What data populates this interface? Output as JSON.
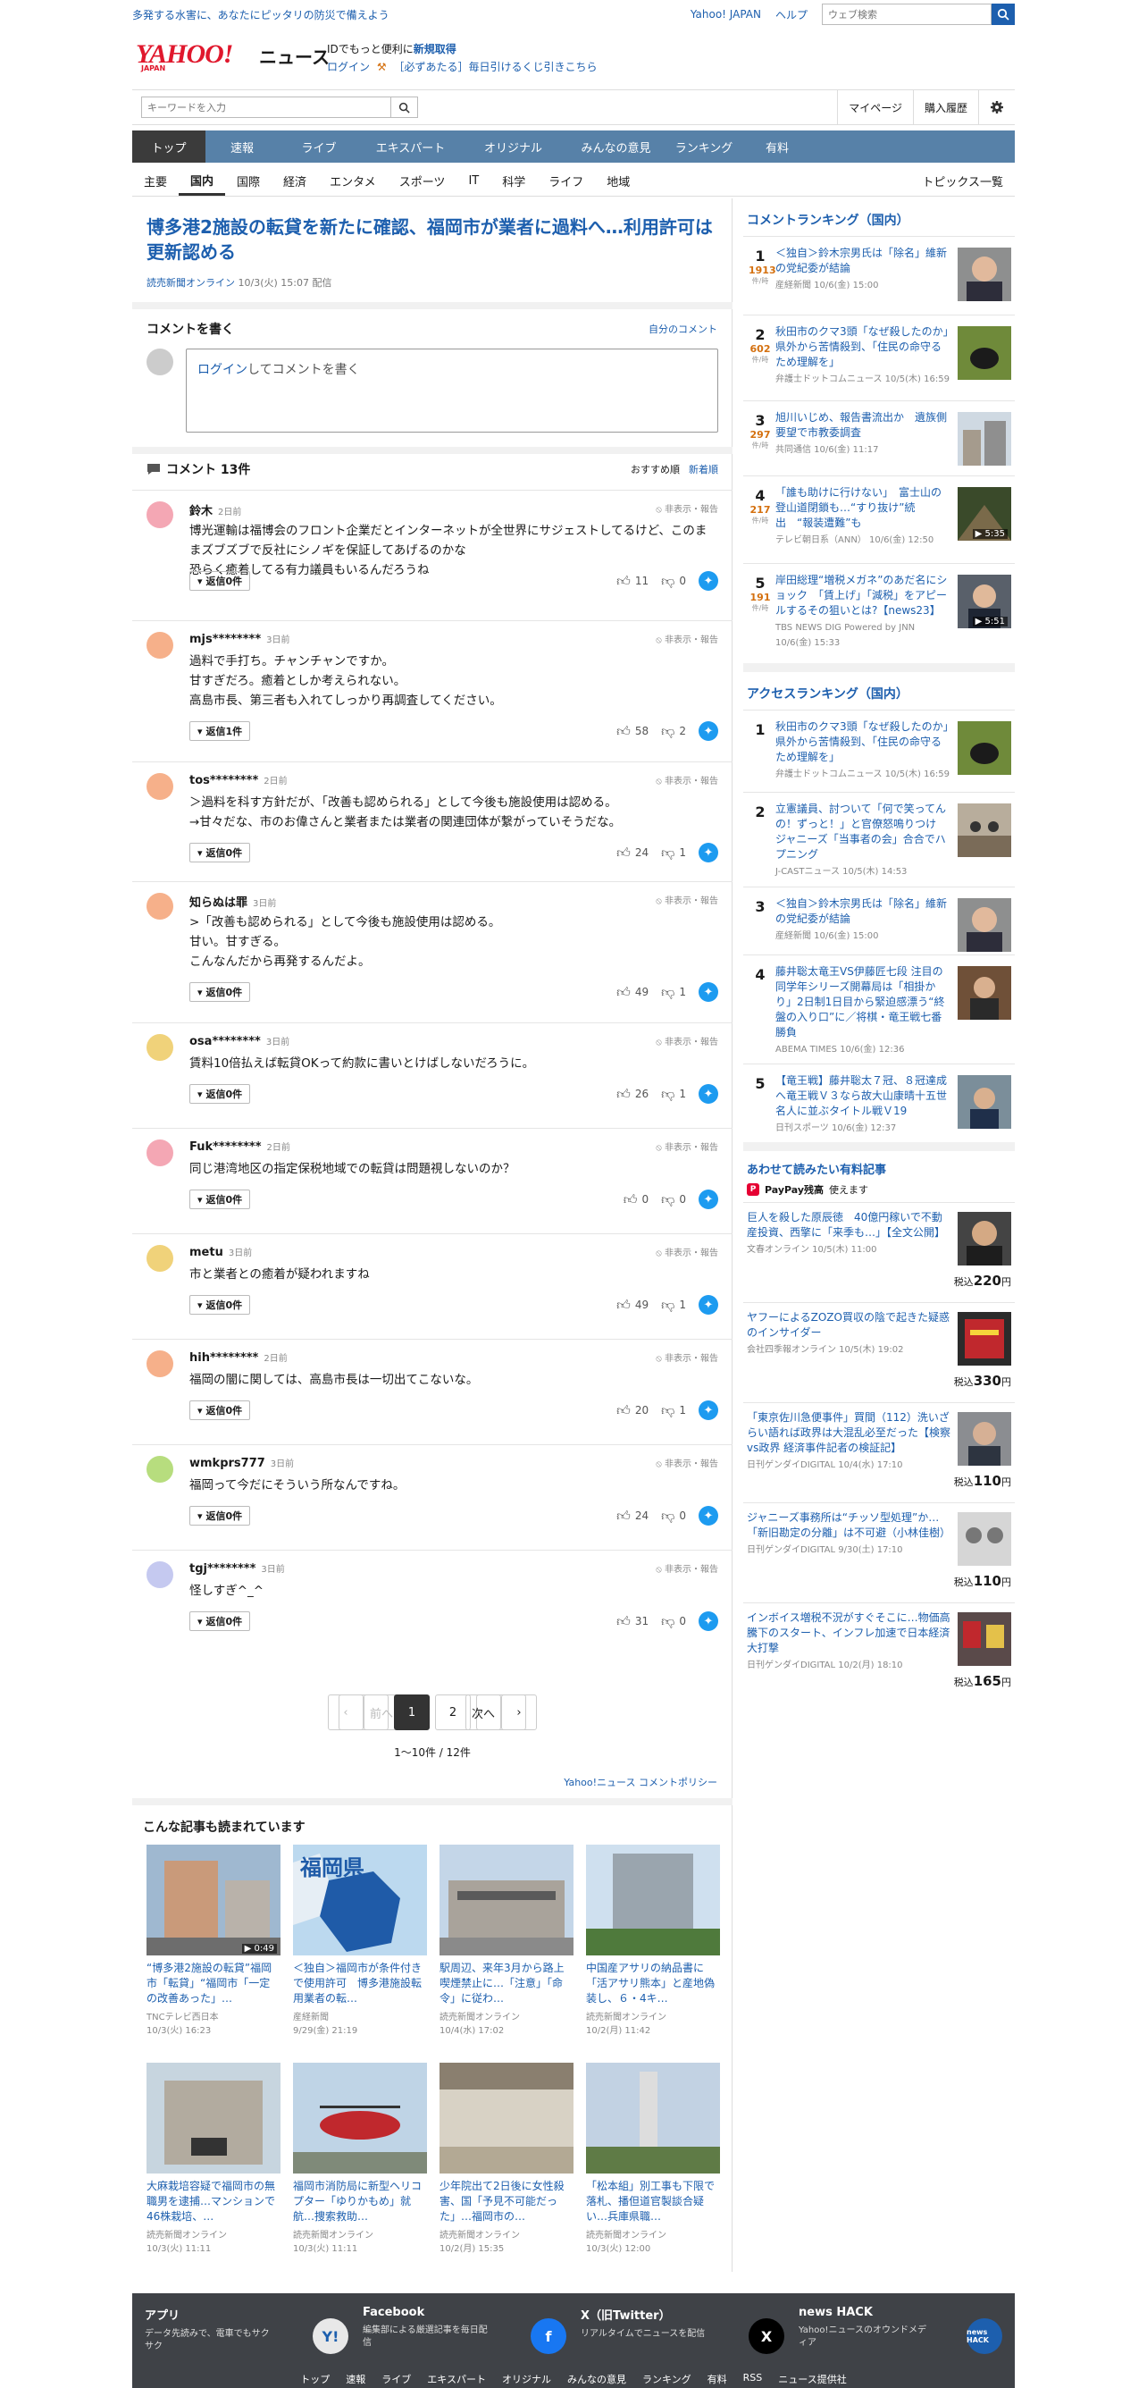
{
  "topbar": {
    "promo": "多発する水害に、あなたにピッタリの防災で備えよう",
    "yahoo_japan": "Yahoo! JAPAN",
    "help": "ヘルプ",
    "search_placeholder": "ウェブ検索"
  },
  "header": {
    "logo": "YAHOO!",
    "logo_sub": "JAPAN",
    "section": "ニュース",
    "id_text": "IDでもっと便利に",
    "signup": "新規取得",
    "login": "ログイン",
    "promo_link": "［必ずあたる］毎日引けるくじ引きこちら"
  },
  "util": {
    "keyword_placeholder": "キーワードを入力",
    "mypage": "マイページ",
    "purchase_history": "購入履歴"
  },
  "gnav": [
    "トップ",
    "速報",
    "ライブ",
    "エキスパート",
    "オリジナル",
    "みんなの意見",
    "ランキング",
    "有料"
  ],
  "cnav": [
    "主要",
    "国内",
    "国際",
    "経済",
    "エンタメ",
    "スポーツ",
    "IT",
    "科学",
    "ライフ",
    "地域"
  ],
  "cnav_topics": "トピックス一覧",
  "article": {
    "title": "博多港2施設の転貸を新たに確認、福岡市が業者に過料へ…利用許可は更新認める",
    "source": "読売新聞オンライン",
    "date": "10/3(火) 15:07 配信"
  },
  "comment_write": {
    "title": "コメントを書く",
    "self_link": "自分のコメント",
    "login": "ログイン",
    "prompt": "してコメントを書く"
  },
  "comments_header": {
    "title": "コメント 13件",
    "sort_recommended": "おすすめ順",
    "sort_new": "新着順"
  },
  "report_label": "非表示・報告",
  "comments": [
    {
      "user": "鈴木",
      "ago": "2日前",
      "body": "博光運輸は福博会のフロント企業だとインターネットが全世界にサジェストしてるけど、このままズブズブで反社にシノギを保証してあげるのかな\n恐らく癒着してる有力議員もいるんだろうね",
      "reply": "返信0件",
      "likes": "11",
      "dislikes": "0",
      "avatar_color": "#f4a7b4"
    },
    {
      "user": "mjs********",
      "ago": "3日前",
      "body": "過料で手打ち。チャンチャンですか。\n甘すぎだろ。癒着としか考えられない。\n高島市長、第三者も入れてしっかり再調査してください。",
      "reply": "返信1件",
      "likes": "58",
      "dislikes": "2",
      "avatar_color": "#f6b08a"
    },
    {
      "user": "tos********",
      "ago": "2日前",
      "body": "＞過料を科す方針だが、「改善も認められる」として今後も施設使用は認める。\n→甘々だな、市のお偉さんと業者または業者の関連団体が繋がっていそうだな。",
      "reply": "返信0件",
      "likes": "24",
      "dislikes": "1",
      "avatar_color": "#f6b08a"
    },
    {
      "user": "知らぬは罪",
      "ago": "3日前",
      "body": ">「改善も認められる」として今後も施設使用は認める。\n甘い。甘すぎる。\nこんなんだから再発するんだよ。",
      "reply": "返信0件",
      "likes": "49",
      "dislikes": "1",
      "avatar_color": "#f6b08a"
    },
    {
      "user": "osa********",
      "ago": "3日前",
      "body": "賃料10倍払えば転貸OKって約款に書いとけばしないだろうに。",
      "reply": "返信0件",
      "likes": "26",
      "dislikes": "1",
      "avatar_color": "#f0d27a"
    },
    {
      "user": "Fuk********",
      "ago": "2日前",
      "body": "同じ港湾地区の指定保税地域での転貸は問題視しないのか？",
      "reply": "返信0件",
      "likes": "0",
      "dislikes": "0",
      "avatar_color": "#f4a7b4"
    },
    {
      "user": "metu",
      "ago": "3日前",
      "body": "市と業者との癒着が疑われますね",
      "reply": "返信0件",
      "likes": "49",
      "dislikes": "1",
      "avatar_color": "#f0d27a"
    },
    {
      "user": "hih********",
      "ago": "2日前",
      "body": "福岡の闇に関しては、高島市長は一切出てこないな。",
      "reply": "返信0件",
      "likes": "20",
      "dislikes": "1",
      "avatar_color": "#f6b08a"
    },
    {
      "user": "wmkprs777",
      "ago": "3日前",
      "body": "福岡って今だにそういう所なんですね。",
      "reply": "返信0件",
      "likes": "24",
      "dislikes": "0",
      "avatar_color": "#b7dd7e"
    },
    {
      "user": "tgj********",
      "ago": "3日前",
      "body": "怪しすぎ^_^",
      "reply": "返信0件",
      "likes": "31",
      "dislikes": "0",
      "avatar_color": "#c5c9f0"
    }
  ],
  "pager": {
    "prev": "前へ",
    "pages": [
      "1",
      "2"
    ],
    "next": "次へ",
    "count": "1〜10件 / 12件"
  },
  "policy": "Yahoo!ニュース コメントポリシー",
  "related": {
    "title": "こんな記事も読まれています",
    "items": [
      {
        "title": "“博多港2施設の転貸”福岡市「転貸」“福岡市「一定の改善あった」…",
        "source": "TNCテレビ西日本",
        "date": "10/3(火) 16:23",
        "badge": "0:49",
        "img": "building"
      },
      {
        "title": "＜独自＞福岡市が条件付きで使用許可　博多港施設転用業者の転…",
        "source": "産経新聞",
        "date": "9/29(金) 21:19",
        "img": "map",
        "map_label": "福岡県"
      },
      {
        "title": "駅周辺、来年3月から路上喫煙禁止に…「注意」「命令」に従わ…",
        "source": "読売新聞オンライン",
        "date": "10/4(水) 17:02",
        "img": "station"
      },
      {
        "title": "中国産アサリの納品書に「活アサリ熊本」と産地偽装し、６・4キ…",
        "source": "読売新聞オンライン",
        "date": "10/2(月) 11:42",
        "img": "office"
      },
      {
        "title": "大麻栽培容疑で福岡市の無職男を逮捕…マンションで46株栽培、…",
        "source": "読売新聞オンライン",
        "date": "10/3(火) 11:11",
        "img": "police"
      },
      {
        "title": "福岡市消防局に新型ヘリコプター「ゆりかもめ」就航…捜索救助…",
        "source": "読売新聞オンライン",
        "date": "10/3(火) 11:11",
        "img": "heli"
      },
      {
        "title": "少年院出て2日後に女性殺害、国「予見不可能だった」…福岡市の…",
        "source": "読売新聞オンライン",
        "date": "10/2(月) 15:35",
        "img": "mall"
      },
      {
        "title": "「松本組」別工事も下限で落札、播但道官製談合疑い…兵庫県職…",
        "source": "読売新聞オンライン",
        "date": "10/3(火) 12:00",
        "img": "sign"
      }
    ]
  },
  "comment_ranking": {
    "title": "コメントランキング（国内）",
    "unit": "件/時",
    "items": [
      {
        "rank": "1",
        "count": "1913",
        "title": "＜独自＞鈴木宗男氏は「除名」維新の党紀委が結論",
        "meta": "産経新聞 10/6(金) 15:00",
        "img": "man"
      },
      {
        "rank": "2",
        "count": "602",
        "title": "秋田市のクマ3頭「なぜ殺したのか」　県外から苦情殺到、「住民の命守るため理解を」",
        "meta": "弁護士ドットコムニュース 10/5(木) 16:59",
        "img": "bear"
      },
      {
        "rank": "3",
        "count": "297",
        "title": "旭川いじめ、報告書流出か　遺族側要望で市教委調査",
        "meta": "共同通信 10/6(金) 11:17",
        "img": "city"
      },
      {
        "rank": "4",
        "count": "217",
        "title": "「誰も助けに行けない」　富士山の登山道閉鎖も…“すり抜け”続出　“報装遭難”も",
        "meta": "テレビ朝日系（ANN） 10/6(金) 12:50",
        "img": "mountain",
        "badge": "5:35"
      },
      {
        "rank": "5",
        "count": "191",
        "title": "岸田総理“増税メガネ”のあだ名にショック　「賃上げ」「減税」をアピールするその狙いとは?【news23】",
        "meta": "TBS NEWS DIG Powered by JNN 10/6(金) 15:33",
        "img": "pm",
        "badge": "5:51"
      }
    ]
  },
  "access_ranking": {
    "title": "アクセスランキング（国内）",
    "items": [
      {
        "rank": "1",
        "title": "秋田市のクマ3頭「なぜ殺したのか」　県外から苦情殺到、「住民の命守るため理解を」",
        "meta": "弁護士ドットコムニュース 10/5(木) 16:59",
        "img": "bear"
      },
      {
        "rank": "2",
        "title": "立憲議員、討ついて「何で笑ってんの！ずっと！」と官僚怒鳴りつけ　ジャニーズ「当事者の会」合合でハプニング",
        "meta": "J-CASTニュース 10/5(木) 14:53",
        "img": "meeting"
      },
      {
        "rank": "3",
        "title": "＜独自＞鈴木宗男氏は「除名」維新の党紀委が結論",
        "meta": "産経新聞 10/6(金) 15:00",
        "img": "man"
      },
      {
        "rank": "4",
        "title": "藤井聡太竜王VS伊藤匠七段 注目の同学年シリーズ開幕局は「相掛かり」2日制1日目から緊迫感漂う“終盤の入り口”に／将棋・竜王戦七番勝負",
        "meta": "ABEMA TIMES 10/6(金) 12:36",
        "img": "shogi"
      },
      {
        "rank": "5",
        "title": "【竜王戦】藤井聡太７冠、８冠達成へ竜王戦Ｖ３なら故大山康晴十五世名人に並ぶタイトル戦Ｖ19",
        "meta": "日刊スポーツ 10/6(金) 12:37",
        "img": "shogi2"
      }
    ]
  },
  "paid": {
    "title": "あわせて読みたい有料記事",
    "paypay": "PayPay残高",
    "paypay_suffix": "使えます",
    "tax_label": "税込",
    "yen": "円",
    "items": [
      {
        "title": "巨人を殺した原辰徳　40億円稼いで不動産投資、西擎に「来季も…」【全文公開】",
        "meta": "文春オンライン 10/5(木) 11:00",
        "price": "220",
        "img": "hara"
      },
      {
        "title": "ヤフーによるZOZO買収の陰で起きた疑惑のインサイダー",
        "meta": "会社四季報オンライン 10/5(木) 19:02",
        "price": "330",
        "img": "book"
      },
      {
        "title": "「東京佐川急便事件」買間（112）洗いざらい語れば政界は大混乱必至だった【検察vs政界 経済事件記者の検証記】",
        "meta": "日刊ゲンダイDIGITAL 10/4(水) 17:10",
        "price": "110",
        "img": "portrait"
      },
      {
        "title": "ジャニーズ事務所は“チッソ型処理”か…「新旧勘定の分離」は不可避（小林佳樹）",
        "meta": "日刊ゲンダイDIGITAL 9/30(土) 17:10",
        "price": "110",
        "img": "press"
      },
      {
        "title": "インボイス増税不況がすぐそこに…物価高騰下のスタート、インフレ加速で日本経済大打撃",
        "meta": "日刊ゲンダイDIGITAL 10/2(月) 18:10",
        "price": "165",
        "img": "street"
      }
    ]
  },
  "footer": {
    "cards": [
      {
        "title": "アプリ",
        "desc": "データ先読みで、電車でもサクサク",
        "icon": "yahoo",
        "icon_text": "Y!"
      },
      {
        "title": "Facebook",
        "desc": "編集部による厳選記事を毎日配信",
        "icon": "facebook",
        "icon_text": "f"
      },
      {
        "title": "X（旧Twitter）",
        "desc": "リアルタイムでニュースを配信",
        "icon": "x",
        "icon_text": "X"
      },
      {
        "title": "news HACK",
        "desc": "Yahoo!ニュースのオウンドメディア",
        "icon": "newshack",
        "icon_text": "news HACK"
      }
    ],
    "nav": [
      "トップ",
      "速報",
      "ライブ",
      "エキスパート",
      "オリジナル",
      "みんなの意見",
      "ランキング",
      "有料",
      "RSS",
      "ニュース提供社"
    ]
  }
}
